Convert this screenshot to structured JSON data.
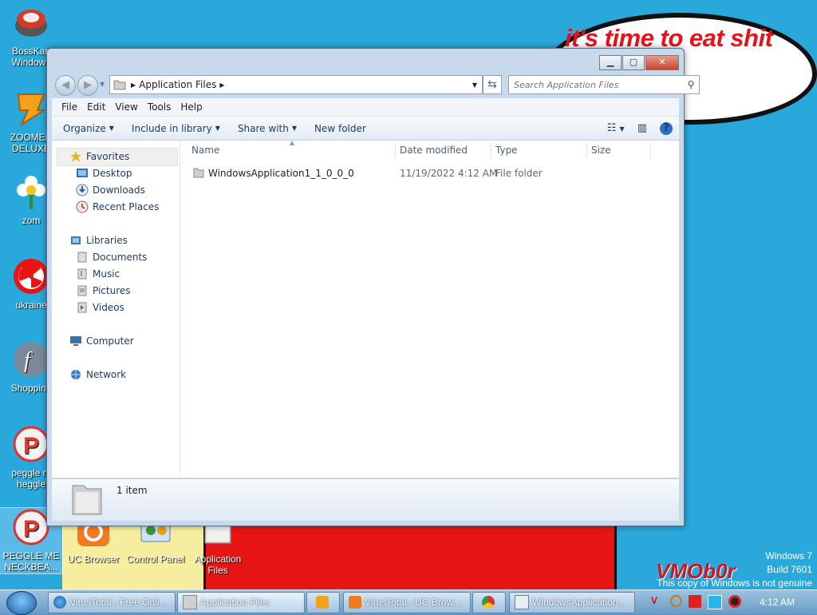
{
  "wallpaper": {
    "speech": "it's time to eat shit\nd chew\nm",
    "watermark": "VMOb0r"
  },
  "desktop_icons": [
    {
      "name": "icon-bosskan",
      "label": "BossKan\nWindows",
      "icon": "bosskan-icon"
    },
    {
      "name": "icon-zoomer",
      "label": "ZOOMER\nDELUXE",
      "icon": "zoomer-icon"
    },
    {
      "name": "icon-zom",
      "label": "zom",
      "icon": "flower-icon"
    },
    {
      "name": "icon-ukraine",
      "label": "ukraine",
      "icon": "radiation-icon"
    },
    {
      "name": "icon-shopping",
      "label": "Shopping",
      "icon": "flash-icon"
    },
    {
      "name": "icon-peggle-heggle",
      "label": "peggle m\nheggle",
      "icon": "peggle-icon"
    },
    {
      "name": "icon-peggle-neckbeard",
      "label": "PEGGLE ME\nNECKBEA...",
      "icon": "peggle-icon"
    },
    {
      "name": "icon-uc-browser",
      "label": "UC Browser",
      "icon": "uc-browser-icon"
    },
    {
      "name": "icon-control-panel",
      "label": "Control Panel",
      "icon": "control-panel-icon"
    },
    {
      "name": "icon-application-files",
      "label": "Application\nFiles",
      "icon": "folder-icon"
    }
  ],
  "windows_notice": {
    "line1": "Windows 7",
    "line2": "Build 7601",
    "line3": "This copy of Windows is not genuine"
  },
  "explorer": {
    "address": "Application Files",
    "search_placeholder": "Search Application Files",
    "menu": [
      "File",
      "Edit",
      "View",
      "Tools",
      "Help"
    ],
    "commands": {
      "organize": "Organize",
      "include": "Include in library",
      "share": "Share with",
      "new_folder": "New folder"
    },
    "nav": {
      "favorites": "Favorites",
      "desktop": "Desktop",
      "downloads": "Downloads",
      "recent": "Recent Places",
      "libraries": "Libraries",
      "documents": "Documents",
      "music": "Music",
      "pictures": "Pictures",
      "videos": "Videos",
      "computer": "Computer",
      "network": "Network"
    },
    "columns": {
      "name": "Name",
      "date": "Date modified",
      "type": "Type",
      "size": "Size"
    },
    "files": [
      {
        "name": "WindowsApplication1_1_0_0_0",
        "date": "11/19/2022 4:12 AM",
        "type": "File folder",
        "size": ""
      }
    ],
    "status": "1 item"
  },
  "taskbar": {
    "items": [
      {
        "label": "VirusTotal - Free Onli...",
        "icon": "ie-icon"
      },
      {
        "label": "Application Files",
        "icon": "folder-icon"
      },
      {
        "label": "",
        "icon": "media-player-icon"
      },
      {
        "label": "VirusTotal - UC Brow...",
        "icon": "uc-browser-icon"
      },
      {
        "label": "",
        "icon": "chrome-icon"
      },
      {
        "label": "WindowsApplication...",
        "icon": "vb-app-icon"
      }
    ],
    "clock": "4:12 AM"
  },
  "colors": {
    "desktop": "#29a8dc",
    "accent": "#e5121b"
  }
}
